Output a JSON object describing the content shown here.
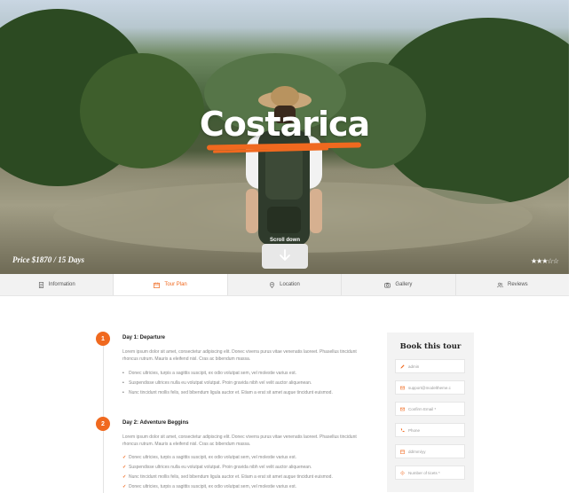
{
  "hero": {
    "title": "Costarica",
    "price": "Price $1870 / 15 Days",
    "scroll_label": "Scroll down",
    "rating_stars": "★★★☆☆",
    "rating_value": 3,
    "accent_color": "#f0691f"
  },
  "tabs": [
    {
      "label": "Information",
      "icon": "document-icon",
      "active": false
    },
    {
      "label": "Tour Plan",
      "icon": "calendar-icon",
      "active": true
    },
    {
      "label": "Location",
      "icon": "map-pin-icon",
      "active": false
    },
    {
      "label": "Gallery",
      "icon": "camera-icon",
      "active": false
    },
    {
      "label": "Reviews",
      "icon": "users-icon",
      "active": false
    }
  ],
  "plan": {
    "days": [
      {
        "number": "1",
        "title": "Day 1: Departure",
        "text": "Lorem ipsum dolor sit amet, consectetur adipiscing elit. Donec viverra purus vitae venenatis laoreet. Phasellus tincidunt rhoncus rutrum. Mauris a eleifend nisl. Cras ac bibendum massa.",
        "items": [
          "Donec ultricies, turpis a sagittis suscipit, ex odio volutpat sem, vel molestie varius est.",
          "Suspendisse ultrices nulla eu volutpat volutpat. Proin gravida nibh vel velit auctor aliquenean.",
          "Nunc tincidunt mollis felis, sed bibendum ligula auctor et. Etiam a erat sit amet augue tincidunt euismod."
        ]
      },
      {
        "number": "2",
        "title": "Day 2: Adventure Beggins",
        "text": "Lorem ipsum dolor sit amet, consectetur adipiscing elit. Donec viverra purus vitae venenatis laoreet. Phasellus tincidunt rhoncus rutrum. Mauris a eleifend nisl. Cras ac bibendum massa.",
        "items": [
          "Donec ultricies, turpis a sagittis suscipit, ex odio volutpat sem, vel molestie varius est.",
          "Suspendisse ultrices nulla eu volutpat volutpat. Proin gravida nibh vel velit auctor aliquenean.",
          "Nunc tincidunt mollis felis, sed bibendum ligula auctor et. Etiam a erat sit amet augue tincidunt euismod.",
          "Donec ultricies, turpis a sagittis suscipit, ex odio volutpat sem, vel molestie varius est."
        ]
      }
    ]
  },
  "booking": {
    "title": "Book this tour",
    "fields": [
      {
        "placeholder": "admin",
        "icon": "pencil-icon"
      },
      {
        "placeholder": "support@modeltheme.c",
        "icon": "email-icon"
      },
      {
        "placeholder": "Confirm Email *",
        "icon": "email-icon"
      },
      {
        "placeholder": "Phone",
        "icon": "phone-icon"
      },
      {
        "placeholder": "dd/mm/yy",
        "icon": "calendar-icon"
      },
      {
        "placeholder": "Number of ticets *",
        "icon": "ticket-icon"
      }
    ]
  }
}
